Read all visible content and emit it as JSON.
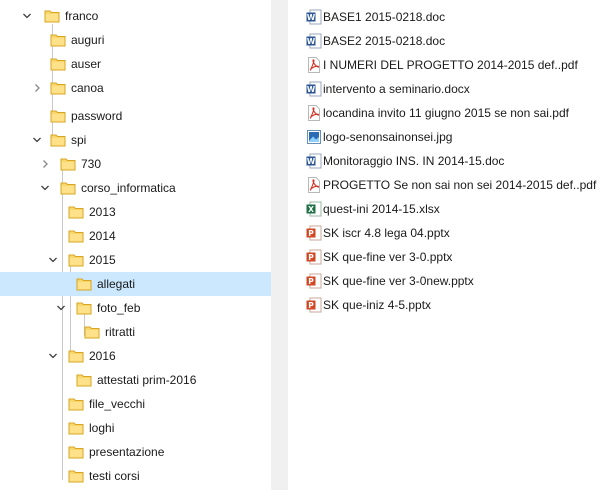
{
  "tree": {
    "items": [
      {
        "label": "franco",
        "arrow": "down"
      },
      {
        "label": "auguri",
        "arrow": "none"
      },
      {
        "label": "auser",
        "arrow": "none"
      },
      {
        "label": "canoa",
        "arrow": "right"
      },
      {
        "label": "password",
        "arrow": "none"
      },
      {
        "label": "spi",
        "arrow": "down"
      },
      {
        "label": "730",
        "arrow": "right"
      },
      {
        "label": "corso_informatica",
        "arrow": "down"
      },
      {
        "label": "2013",
        "arrow": "none"
      },
      {
        "label": "2014",
        "arrow": "none"
      },
      {
        "label": "2015",
        "arrow": "down"
      },
      {
        "label": "allegati",
        "arrow": "none",
        "selected": true
      },
      {
        "label": "foto_feb",
        "arrow": "down"
      },
      {
        "label": "ritratti",
        "arrow": "none"
      },
      {
        "label": "2016",
        "arrow": "down"
      },
      {
        "label": "attestati prim-2016",
        "arrow": "none"
      },
      {
        "label": "file_vecchi",
        "arrow": "none"
      },
      {
        "label": "loghi",
        "arrow": "none"
      },
      {
        "label": "presentazione",
        "arrow": "none"
      },
      {
        "label": "testi corsi",
        "arrow": "none"
      }
    ]
  },
  "files": {
    "items": [
      {
        "name": "BASE1 2015-0218.doc",
        "icon": "word-icon"
      },
      {
        "name": "BASE2 2015-0218.doc",
        "icon": "word-icon"
      },
      {
        "name": "I NUMERI DEL PROGETTO 2014-2015 def..pdf",
        "icon": "pdf-icon"
      },
      {
        "name": "intervento a seminario.docx",
        "icon": "word-icon"
      },
      {
        "name": "locandina invito 11 giugno 2015 se non sai.pdf",
        "icon": "pdf-icon"
      },
      {
        "name": "logo-senonsainonsei.jpg",
        "icon": "image-icon"
      },
      {
        "name": "Monitoraggio INS. IN 2014-15.doc",
        "icon": "word-icon"
      },
      {
        "name": "PROGETTO Se non sai non sei 2014-2015 def..pdf",
        "icon": "pdf-icon"
      },
      {
        "name": "quest-ini 2014-15.xlsx",
        "icon": "excel-icon"
      },
      {
        "name": "SK iscr 4.8 lega 04.pptx",
        "icon": "powerpoint-icon"
      },
      {
        "name": "SK que-fine ver 3-0.pptx",
        "icon": "powerpoint-icon"
      },
      {
        "name": "SK que-fine ver 3-0new.pptx",
        "icon": "powerpoint-icon"
      },
      {
        "name": "SK que-iniz 4-5.pptx",
        "icon": "powerpoint-icon"
      }
    ]
  },
  "colors": {
    "selection": "#cce8ff",
    "folder": "#f7d66b",
    "word": "#2b5797",
    "pdf": "#d93025",
    "excel": "#1e7145",
    "powerpoint": "#d24726"
  }
}
